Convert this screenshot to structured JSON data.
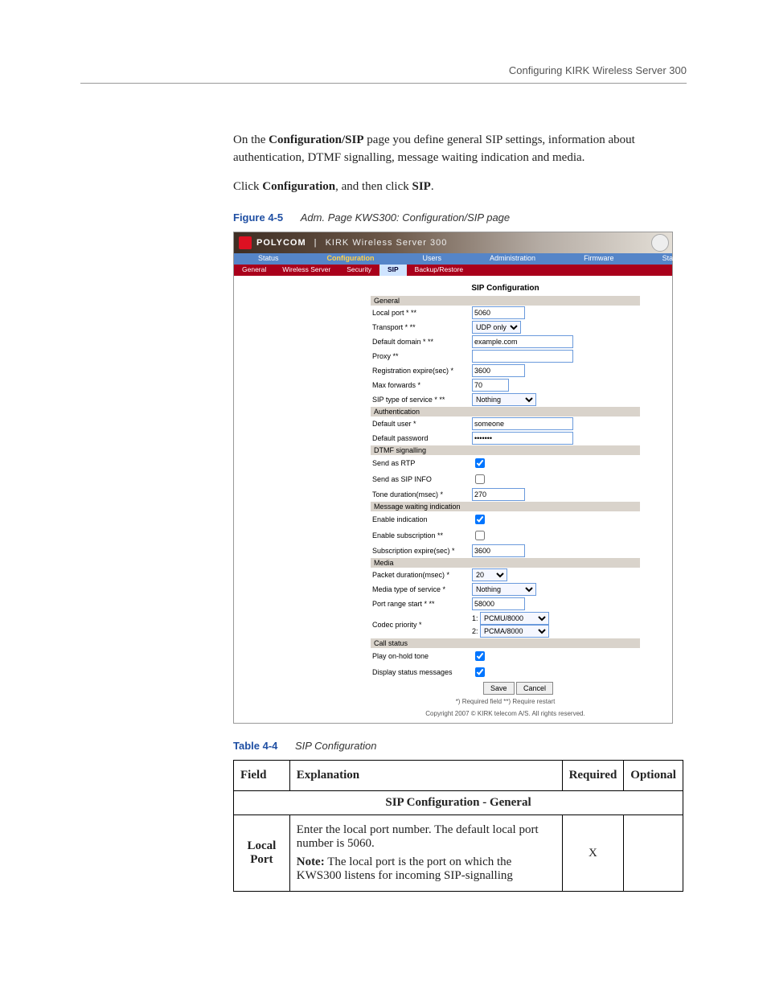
{
  "header_running": "Configuring KIRK Wireless Server 300",
  "intro_html": "On the <b data-name='inline-bold'>Configuration/SIP</b> page you define general SIP settings, information about authentication, DTMF signalling, message waiting indication and media.",
  "click_html": "Click <b data-name='inline-bold'>Configuration</b>, and then click <b data-name='inline-bold'>SIP</b>.",
  "fig_label": "Figure 4-5",
  "fig_title": "Adm. Page KWS300: Configuration/SIP page",
  "shot": {
    "brand": "POLYCOM",
    "product": "KIRK Wireless Server 300",
    "tabs1": [
      "Status",
      "Configuration",
      "Users",
      "Administration",
      "Firmware",
      "Statistics"
    ],
    "tabs1_active": "Configuration",
    "tabs2": [
      "General",
      "Wireless Server",
      "Security",
      "SIP",
      "Backup/Restore"
    ],
    "tabs2_active": "SIP",
    "page_title": "SIP Configuration",
    "sections": {
      "general": "General",
      "auth": "Authentication",
      "dtmf": "DTMF signalling",
      "mwi": "Message waiting indication",
      "media": "Media",
      "call": "Call status"
    },
    "fields": {
      "local_port": {
        "label": "Local port * **",
        "value": "5060"
      },
      "transport": {
        "label": "Transport * **",
        "value": "UDP only"
      },
      "default_domain": {
        "label": "Default domain * **",
        "value": "example.com"
      },
      "proxy": {
        "label": "Proxy **",
        "value": ""
      },
      "reg_expire": {
        "label": "Registration expire(sec) *",
        "value": "3600"
      },
      "max_forwards": {
        "label": "Max forwards *",
        "value": "70"
      },
      "sip_tos": {
        "label": "SIP type of service * **",
        "value": "Nothing"
      },
      "def_user": {
        "label": "Default user *",
        "value": "someone"
      },
      "def_pass": {
        "label": "Default password",
        "value": "•••••••"
      },
      "send_rtp": {
        "label": "Send as RTP",
        "checked": true
      },
      "send_info": {
        "label": "Send as SIP INFO",
        "checked": false
      },
      "tone_dur": {
        "label": "Tone duration(msec) *",
        "value": "270"
      },
      "enable_ind": {
        "label": "Enable indication",
        "checked": true
      },
      "enable_sub": {
        "label": "Enable subscription **",
        "checked": false
      },
      "sub_expire": {
        "label": "Subscription expire(sec) *",
        "value": "3600"
      },
      "packet_dur": {
        "label": "Packet duration(msec) *",
        "value": "20"
      },
      "media_tos": {
        "label": "Media type of service *",
        "value": "Nothing"
      },
      "port_range": {
        "label": "Port range start * **",
        "value": "58000"
      },
      "codec_priority": {
        "label": "Codec priority *",
        "opt1": "PCMU/8000",
        "opt2": "PCMA/8000"
      },
      "play_hold": {
        "label": "Play on-hold tone",
        "checked": true
      },
      "disp_status": {
        "label": "Display status messages",
        "checked": true
      }
    },
    "buttons": {
      "save": "Save",
      "cancel": "Cancel"
    },
    "foot1": "*) Required field **) Require restart",
    "foot2": "Copyright 2007 © KIRK telecom A/S. All rights reserved."
  },
  "tbl_label": "Table 4-4",
  "tbl_title": "SIP Configuration",
  "ref_headers": {
    "field": "Field",
    "explanation": "Explanation",
    "required": "Required",
    "optional": "Optional"
  },
  "ref_section": "SIP Configuration - General",
  "ref_row1": {
    "field": "Local Port",
    "explanation1": "Enter the local port number. The default local port number is 5060.",
    "note_lead": "Note:",
    "explanation2": "  The local port is the port on which the KWS300 listens for incoming SIP-signalling",
    "required": "X",
    "optional": ""
  }
}
